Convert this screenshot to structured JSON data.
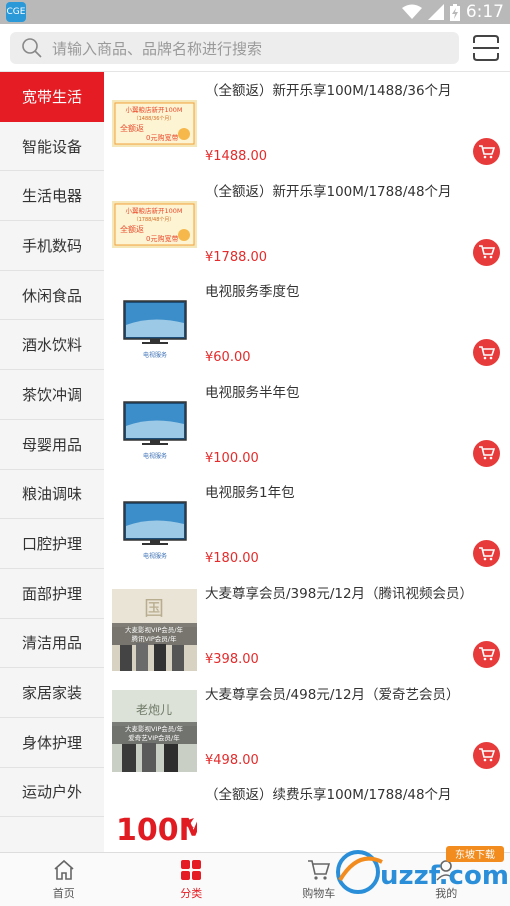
{
  "status_bar": {
    "app_icon_label": "CGE",
    "time": "6:17"
  },
  "search": {
    "placeholder": "请输入商品、品牌名称进行搜索"
  },
  "sidebar": {
    "items": [
      {
        "label": "宽带生活",
        "active": true
      },
      {
        "label": "智能设备"
      },
      {
        "label": "生活电器"
      },
      {
        "label": "手机数码"
      },
      {
        "label": "休闲食品"
      },
      {
        "label": "酒水饮料"
      },
      {
        "label": "茶饮冲调"
      },
      {
        "label": "母婴用品"
      },
      {
        "label": "粮油调味"
      },
      {
        "label": "口腔护理"
      },
      {
        "label": "面部护理"
      },
      {
        "label": "清洁用品"
      },
      {
        "label": "家居家装"
      },
      {
        "label": "身体护理"
      },
      {
        "label": "运动户外"
      },
      {
        "label": ""
      }
    ]
  },
  "products": [
    {
      "title": "（全额返）新开乐享100M/1488/36个月",
      "price": "¥1488.00",
      "thumb": "broadband",
      "thumb_text": {
        "line1": "小翼粮店新开100M",
        "line2": "（1488/36个月）",
        "badge": "全额返",
        "tag": "0元购宽带"
      }
    },
    {
      "title": "（全额返）新开乐享100M/1788/48个月",
      "price": "¥1788.00",
      "thumb": "broadband",
      "thumb_text": {
        "line1": "小翼粮店新开100M",
        "line2": "（1788/48个月）",
        "badge": "全额返",
        "tag": "0元购宽带"
      }
    },
    {
      "title": "电视服务季度包",
      "price": "¥60.00",
      "thumb": "tv",
      "thumb_text": {
        "caption": "电视服务"
      }
    },
    {
      "title": "电视服务半年包",
      "price": "¥100.00",
      "thumb": "tv",
      "thumb_text": {
        "caption": "电视服务"
      }
    },
    {
      "title": "电视服务1年包",
      "price": "¥180.00",
      "thumb": "tv",
      "thumb_text": {
        "caption": "电视服务"
      }
    },
    {
      "title": "大麦尊享会员/398元/12月（腾讯视频会员）",
      "price": "¥398.00",
      "thumb": "vip-tencent",
      "thumb_text": {
        "line1": "大麦影视VIP会员/年",
        "line2": "腾讯VIP会员/年"
      }
    },
    {
      "title": "大麦尊享会员/498元/12月（爱奇艺会员）",
      "price": "¥498.00",
      "thumb": "vip-iqiyi",
      "thumb_text": {
        "line1": "大麦影视VIP会员/年",
        "line2": "爱奇艺VIP会员/年"
      }
    },
    {
      "title": "（全额返）续费乐享100M/1788/48个月",
      "price": "",
      "thumb": "100m",
      "thumb_text": {
        "big": "100M"
      }
    }
  ],
  "bottom_nav": [
    {
      "label": "首页",
      "icon": "home-icon"
    },
    {
      "label": "分类",
      "icon": "category-icon",
      "active": true
    },
    {
      "label": "购物车",
      "icon": "cart-icon"
    },
    {
      "label": "我的",
      "icon": "user-icon"
    }
  ],
  "watermark": {
    "text": "uzzf.com",
    "tag": "东坡下载"
  },
  "colors": {
    "accent": "#e51c23",
    "price": "#e52b2b",
    "cart_button": "#e73b3b"
  }
}
